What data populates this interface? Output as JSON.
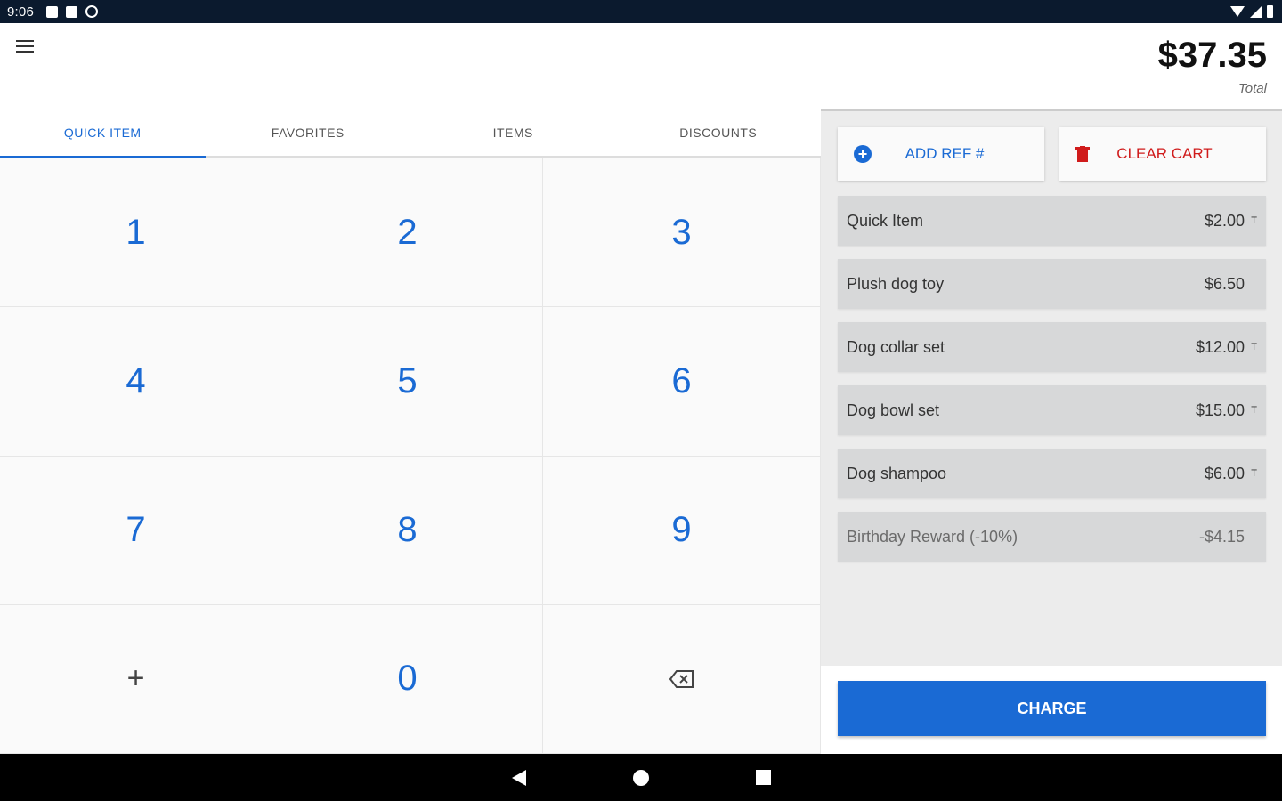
{
  "status_bar": {
    "time": "9:06"
  },
  "header": {
    "total_amount": "$37.35",
    "total_label": "Total"
  },
  "tabs": [
    {
      "label": "QUICK ITEM",
      "active": true
    },
    {
      "label": "FAVORITES",
      "active": false
    },
    {
      "label": "ITEMS",
      "active": false
    },
    {
      "label": "DISCOUNTS",
      "active": false
    }
  ],
  "keypad": {
    "keys": [
      "1",
      "2",
      "3",
      "4",
      "5",
      "6",
      "7",
      "8",
      "9",
      "+",
      "0"
    ]
  },
  "actions": {
    "add_ref_label": "ADD REF #",
    "clear_cart_label": "CLEAR CART"
  },
  "cart": {
    "items": [
      {
        "name": "Quick Item",
        "price": "$2.00",
        "tax": "T"
      },
      {
        "name": "Plush dog toy",
        "price": "$6.50",
        "tax": ""
      },
      {
        "name": "Dog collar set",
        "price": "$12.00",
        "tax": "T"
      },
      {
        "name": "Dog bowl set",
        "price": "$15.00",
        "tax": "T"
      },
      {
        "name": "Dog shampoo",
        "price": "$6.00",
        "tax": "T"
      },
      {
        "name": "Birthday Reward (-10%)",
        "price": "-$4.15",
        "tax": ""
      }
    ]
  },
  "charge": {
    "label": "CHARGE"
  },
  "colors": {
    "accent": "#1a6ad4",
    "danger": "#d01b1b",
    "status_bar": "#0b1a2e"
  }
}
